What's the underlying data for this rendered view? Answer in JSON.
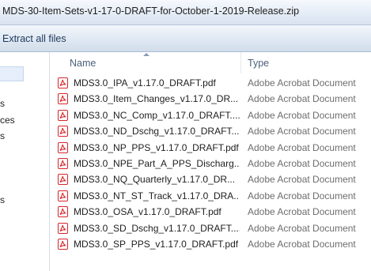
{
  "window": {
    "title": "MDS-30-Item-Sets-v1-17-0-DRAFT-for-October-1-2019-Release.zip"
  },
  "toolbar": {
    "extract_label": "Extract all files"
  },
  "nav": {
    "items": [
      "s",
      "ces",
      "s",
      "s"
    ]
  },
  "columns": {
    "name": "Name",
    "type": "Type"
  },
  "files": [
    {
      "name": "MDS3.0_IPA_v1.17.0_DRAFT.pdf",
      "type": "Adobe Acrobat Document",
      "icon": "pdf-icon"
    },
    {
      "name": "MDS3.0_Item_Changes_v1.17.0_DR...",
      "type": "Adobe Acrobat Document",
      "icon": "pdf-icon"
    },
    {
      "name": "MDS3.0_NC_Comp_v1.17.0_DRAFT....",
      "type": "Adobe Acrobat Document",
      "icon": "pdf-icon"
    },
    {
      "name": "MDS3.0_ND_Dschg_v1.17.0_DRAFT....",
      "type": "Adobe Acrobat Document",
      "icon": "pdf-icon"
    },
    {
      "name": "MDS3.0_NP_PPS_v1.17.0_DRAFT.pdf",
      "type": "Adobe Acrobat Document",
      "icon": "pdf-icon"
    },
    {
      "name": "MDS3.0_NPE_Part_A_PPS_Discharg...",
      "type": "Adobe Acrobat Document",
      "icon": "pdf-icon"
    },
    {
      "name": "MDS3.0_NQ_Quarterly_v1.17.0_DR...",
      "type": "Adobe Acrobat Document",
      "icon": "pdf-icon"
    },
    {
      "name": "MDS3.0_NT_ST_Track_v1.17.0_DRA...",
      "type": "Adobe Acrobat Document",
      "icon": "pdf-icon"
    },
    {
      "name": "MDS3.0_OSA_v1.17.0_DRAFT.pdf",
      "type": "Adobe Acrobat Document",
      "icon": "pdf-icon"
    },
    {
      "name": "MDS3.0_SD_Dschg_v1.17.0_DRAFT....",
      "type": "Adobe Acrobat Document",
      "icon": "pdf-icon"
    },
    {
      "name": "MDS3.0_SP_PPS_v1.17.0_DRAFT.pdf",
      "type": "Adobe Acrobat Document",
      "icon": "pdf-icon"
    }
  ],
  "colors": {
    "pdf_red": "#d7262b",
    "header_text": "#4c607a",
    "type_text": "#6d6d6d",
    "toolbar_text": "#1e395b"
  }
}
